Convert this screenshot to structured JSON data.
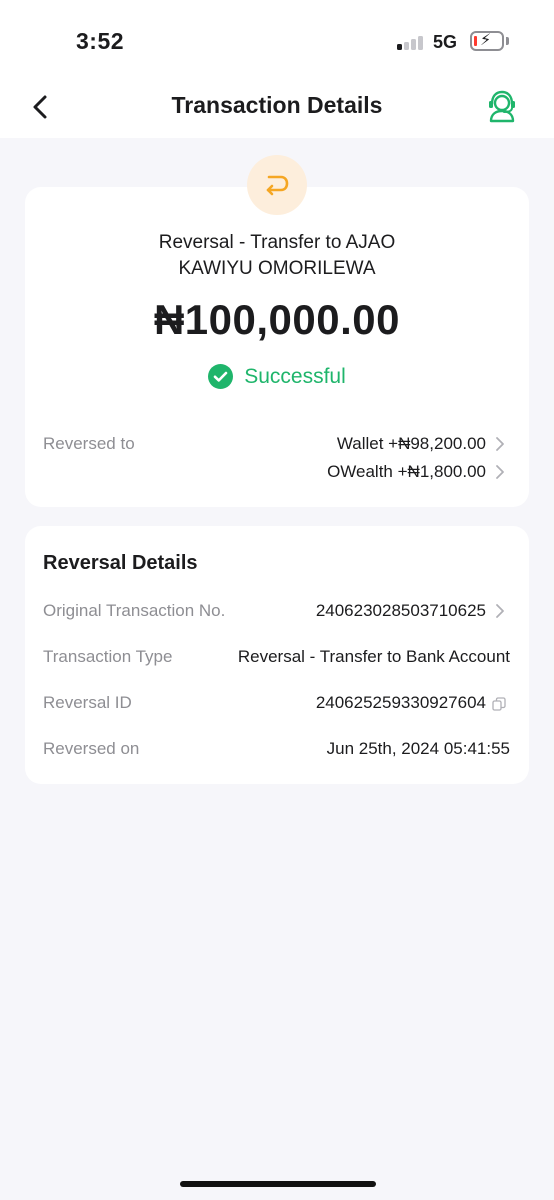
{
  "status_bar": {
    "time": "3:52",
    "network": "5G"
  },
  "header": {
    "title": "Transaction Details"
  },
  "summary": {
    "title": "Reversal - Transfer to AJAO KAWIYU OMORILEWA",
    "amount": "₦100,000.00",
    "status": "Successful",
    "reversed_to_label": "Reversed to",
    "reversed_to": [
      {
        "value": "Wallet +₦98,200.00"
      },
      {
        "value": "OWealth +₦1,800.00"
      }
    ]
  },
  "details": {
    "title": "Reversal Details",
    "rows": [
      {
        "label": "Original Transaction No.",
        "value": "240623028503710625"
      },
      {
        "label": "Transaction Type",
        "value": "Reversal - Transfer to Bank Account"
      },
      {
        "label": "Reversal ID",
        "value": "240625259330927604"
      },
      {
        "label": "Reversed on",
        "value": "Jun 25th, 2024 05:41:55"
      }
    ]
  },
  "colors": {
    "accent_green": "#1fb56b",
    "reversal_orange": "#f5a623",
    "badge_bg": "#fdeedc",
    "background": "#f6f6fa"
  },
  "icons": {
    "back": "chevron-left-icon",
    "support": "headset-support-icon",
    "reversal": "return-arrow-icon",
    "status": "check-circle-icon",
    "row_action": "chevron-right-icon",
    "copy": "copy-icon"
  }
}
